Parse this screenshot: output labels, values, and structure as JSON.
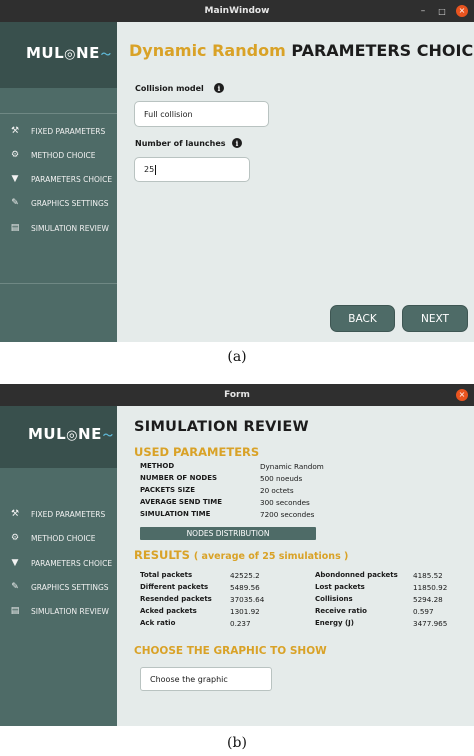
{
  "window_a": {
    "title": "MainWindow",
    "controls": {
      "minimize": "–",
      "maximize": "□",
      "close": "×"
    },
    "logo": "MUL",
    "logo_suffix": "NE",
    "headline_accent": "Dynamic Random",
    "headline_rest": "PARAMETERS CHOICE",
    "collision_label": "Collision model",
    "collision_value": "Full collision",
    "launches_label": "Number of launches",
    "launches_value": "25",
    "back": "BACK",
    "next": "NEXT",
    "icons": {
      "info": "info-icon"
    }
  },
  "nav": [
    {
      "label": "FIXED PARAMETERS",
      "icon": "wrench-icon",
      "glyph": "⚒"
    },
    {
      "label": "METHOD CHOICE",
      "icon": "tools-icon",
      "glyph": "⚙"
    },
    {
      "label": "PARAMETERS CHOICE",
      "icon": "filter-icon",
      "glyph": "▼"
    },
    {
      "label": "GRAPHICS SETTINGS",
      "icon": "brush-icon",
      "glyph": "✎"
    },
    {
      "label": "SIMULATION REVIEW",
      "icon": "document-icon",
      "glyph": "▤"
    }
  ],
  "window_b": {
    "title": "Form",
    "close": "×",
    "logo": "MUL",
    "logo_suffix": "NE",
    "heading": "SIMULATION REVIEW",
    "used_params_title": "USED PARAMETERS",
    "params": [
      {
        "key": "METHOD",
        "value": "Dynamic Random"
      },
      {
        "key": "NUMBER OF NODES",
        "value": "500 noeuds"
      },
      {
        "key": "PACKETS SIZE",
        "value": "20 octets"
      },
      {
        "key": "AVERAGE SEND TIME",
        "value": "300 secondes"
      },
      {
        "key": "SIMULATION TIME",
        "value": "7200 secondes"
      }
    ],
    "nodes_button": "NODES DISTRIBUTION",
    "results_title": "RESULTS",
    "results_subtitle": "( average of 25 simulations )",
    "results_left": [
      {
        "key": "Total packets",
        "value": "42525.2"
      },
      {
        "key": "Different packets",
        "value": "5489.56"
      },
      {
        "key": "Resended packets",
        "value": "37035.64"
      },
      {
        "key": "Acked packets",
        "value": "1301.92"
      },
      {
        "key": "Ack ratio",
        "value": "0.237"
      }
    ],
    "results_right": [
      {
        "key": "Abondonned packets",
        "value": "4185.52"
      },
      {
        "key": "Lost packets",
        "value": "11850.92"
      },
      {
        "key": "Collisions",
        "value": "5294.28"
      },
      {
        "key": "Receive ratio",
        "value": "0.597"
      },
      {
        "key": "Energy (J)",
        "value": "3477.965"
      }
    ],
    "graphic_title": "CHOOSE THE GRAPHIC TO SHOW",
    "graphic_select": "Choose the graphic"
  },
  "caption_a": "(a)",
  "caption_b": "(b)",
  "colors": {
    "accent": "#d9a227",
    "sidebar": "#4e6b67",
    "logo_band": "#39504d",
    "titlebar": "#2f2f2f",
    "content_bg": "#e5ebea",
    "close_button": "#e9541f"
  }
}
